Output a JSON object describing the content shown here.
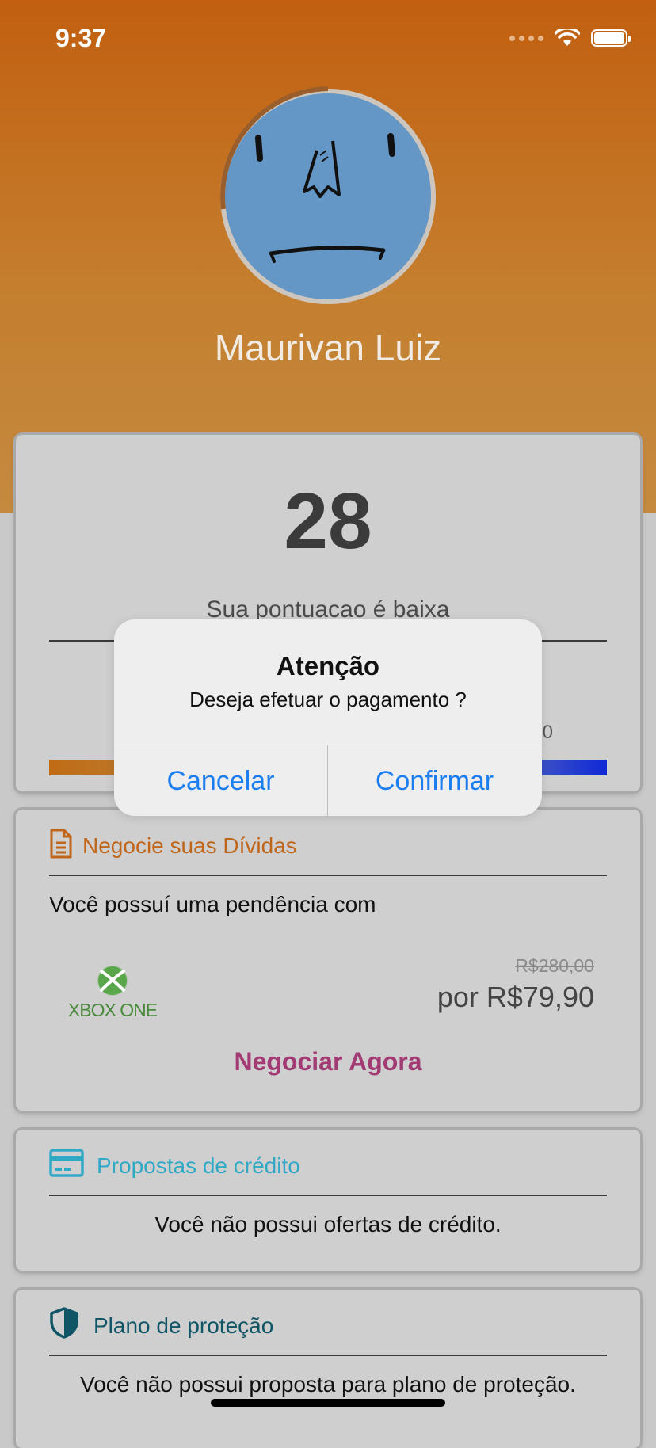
{
  "status_bar": {
    "time": "9:37"
  },
  "profile": {
    "name": "Maurivan Luiz"
  },
  "score_card": {
    "score": "28",
    "message": "Sua pontuacao é baixa",
    "max_label_partial": "0"
  },
  "debts": {
    "title": "Negocie suas Dívidas",
    "pending_text": "Você possuí uma pendência com",
    "logo_text": "XBOX ONE",
    "old_price": "R$280,00",
    "new_price": "por R$79,90",
    "action_label": "Negociar Agora"
  },
  "credit": {
    "title": "Propostas de crédito",
    "empty_text": "Você não possui ofertas de crédito."
  },
  "protection": {
    "title": "Plano de proteção",
    "empty_text": "Você não possui proposta para plano de proteção."
  },
  "alert": {
    "title": "Atenção",
    "message": "Deseja efetuar o pagamento ?",
    "cancel_label": "Cancelar",
    "confirm_label": "Confirmar"
  },
  "colors": {
    "accent_blue": "#1a7ef0",
    "debt_orange": "#c0661a",
    "credit_teal": "#31a9c6",
    "protection_teal": "#0f5566",
    "negociar_purple": "#a23a73"
  }
}
